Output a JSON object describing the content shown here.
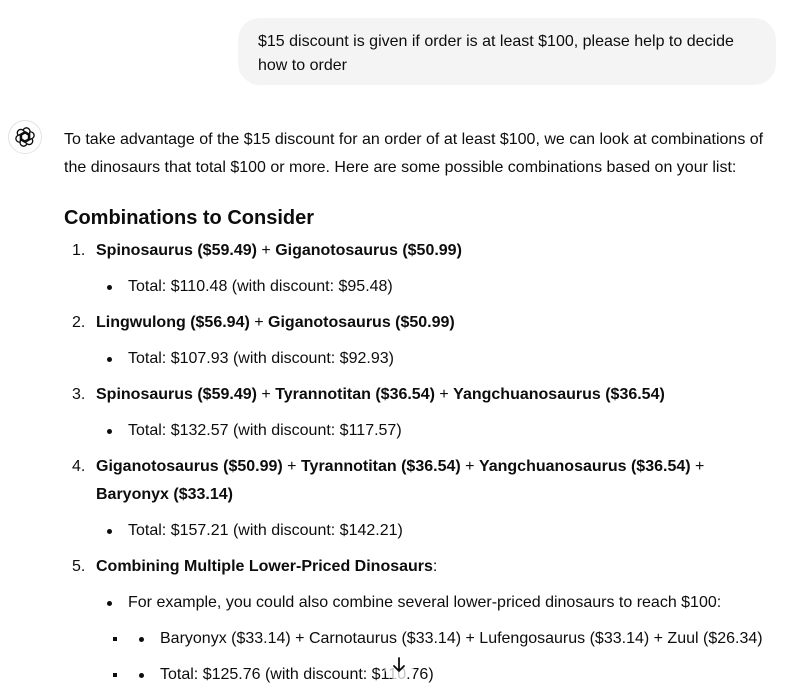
{
  "user_message": {
    "line1": "$15 discount is given if order is at least $100, please help to decide",
    "line2": "how to order"
  },
  "assistant": {
    "avatar_icon": "openai-logo-icon",
    "intro_line1": "To take advantage of the $15 discount for an order of at least $100, we can look at combinations of",
    "intro_line2": "the dinosaurs that total $100 or more. Here are some possible combinations based on your list:",
    "heading": "Combinations to Consider",
    "combos": [
      {
        "num": "1.",
        "parts": [
          {
            "b": "Spinosaurus ($59.49)"
          },
          {
            "t": " + "
          },
          {
            "b": "Giganotosaurus ($50.99)"
          }
        ],
        "total": "Total: $110.48 (with discount: $95.48)"
      },
      {
        "num": "2.",
        "parts": [
          {
            "b": "Lingwulong ($56.94)"
          },
          {
            "t": " + "
          },
          {
            "b": "Giganotosaurus ($50.99)"
          }
        ],
        "total": "Total: $107.93 (with discount: $92.93)"
      },
      {
        "num": "3.",
        "parts": [
          {
            "b": "Spinosaurus ($59.49)"
          },
          {
            "t": " + "
          },
          {
            "b": "Tyrannotitan ($36.54)"
          },
          {
            "t": " + "
          },
          {
            "b": "Yangchuanosaurus ($36.54)"
          }
        ],
        "total": "Total: $132.57 (with discount: $117.57)"
      },
      {
        "num": "4.",
        "parts": [
          {
            "b": "Giganotosaurus ($50.99)"
          },
          {
            "t": " + "
          },
          {
            "b": "Tyrannotitan ($36.54)"
          },
          {
            "t": " + "
          },
          {
            "b": "Yangchuanosaurus ($36.54)"
          },
          {
            "t": " + "
          },
          {
            "b": "Baryonyx ($33.14)"
          }
        ],
        "total": "Total: $157.21 (with discount: $142.21)"
      }
    ],
    "combo5": {
      "num": "5.",
      "title": "Combining Multiple Lower-Priced Dinosaurs",
      "colon": ":",
      "example": "For example, you could also combine several lower-priced dinosaurs to reach $100:",
      "sub_items": [
        "Baryonyx ($33.14) + Carnotaurus ($33.14) + Lufengosaurus ($33.14) + Zuul ($26.34)",
        "Total: $125.76 (with discount: $110.76)"
      ]
    }
  },
  "scroll_button": {
    "icon": "arrow-down-icon"
  }
}
